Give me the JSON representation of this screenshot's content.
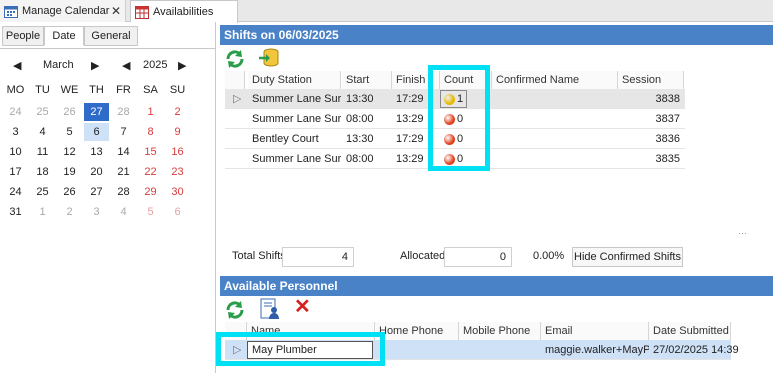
{
  "tabs": [
    {
      "label": "Manage Calendar",
      "close": "✕"
    },
    {
      "label": "Availabilities"
    }
  ],
  "left_tabs": [
    "People",
    "Date",
    "General"
  ],
  "calendar": {
    "month": "March",
    "year": "2025",
    "prev": "◀",
    "next": "▶",
    "dows": [
      "MO",
      "TU",
      "WE",
      "TH",
      "FR",
      "SA",
      "SU"
    ],
    "weeks": [
      [
        "24",
        "25",
        "26",
        "27",
        "28",
        "1",
        "2"
      ],
      [
        "3",
        "4",
        "5",
        "6",
        "7",
        "8",
        "9"
      ],
      [
        "10",
        "11",
        "12",
        "13",
        "14",
        "15",
        "16"
      ],
      [
        "17",
        "18",
        "19",
        "20",
        "21",
        "22",
        "23"
      ],
      [
        "24",
        "25",
        "26",
        "27",
        "28",
        "29",
        "30"
      ],
      [
        "31",
        "1",
        "2",
        "3",
        "4",
        "5",
        "6"
      ]
    ]
  },
  "shifts": {
    "title": "Shifts on  06/03/2025",
    "columns": [
      "Duty Station",
      "Start",
      "Finish",
      "Count",
      "Confirmed Name",
      "Session Code"
    ],
    "rows": [
      {
        "station": "Summer Lane Surg...",
        "start": "13:30",
        "finish": "17:29",
        "count": "1",
        "count_color": "#e6b800",
        "name": "",
        "code": "3838"
      },
      {
        "station": "Summer Lane Surg...",
        "start": "08:00",
        "finish": "13:29",
        "count": "0",
        "count_color": "#e0401c",
        "name": "",
        "code": "3837"
      },
      {
        "station": "Bentley Court",
        "start": "13:30",
        "finish": "17:29",
        "count": "0",
        "count_color": "#e0401c",
        "name": "",
        "code": "3836"
      },
      {
        "station": "Summer Lane Surg...",
        "start": "08:00",
        "finish": "13:29",
        "count": "0",
        "count_color": "#e0401c",
        "name": "",
        "code": "3835"
      }
    ],
    "expander": "▷"
  },
  "stats": {
    "total_label": "Total Shifts",
    "total": "4",
    "allocated_label": "Allocated",
    "allocated": "0",
    "percent": "0.00%",
    "hide_btn": "Hide Confirmed Shifts"
  },
  "personnel": {
    "title": "Available Personnel",
    "columns": [
      "Name",
      "Home Phone",
      "Mobile Phone",
      "Email",
      "Date Submitted"
    ],
    "rows": [
      {
        "name": "May Plumber",
        "home": "",
        "mobile": "",
        "email": "maggie.walker+MayPl...",
        "date": "27/02/2025 14:39"
      }
    ],
    "expander": "▷"
  },
  "colors": {
    "header_bar": "#4a82c8",
    "selected_day": "#2f6cc9",
    "highlight": "#00e0f4"
  }
}
